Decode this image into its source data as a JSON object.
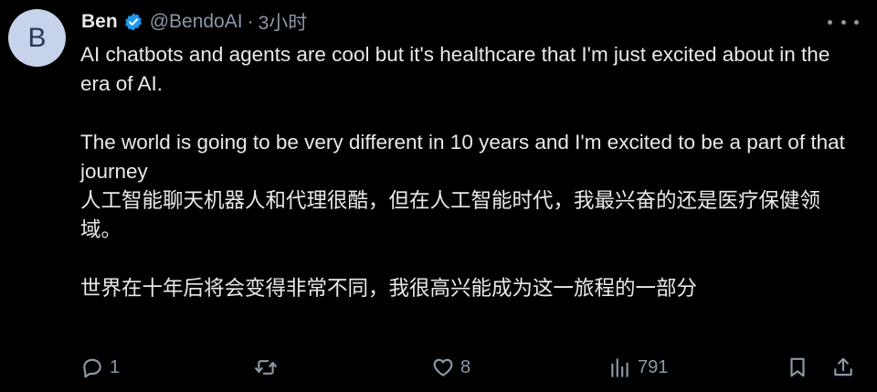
{
  "author": {
    "avatar_letter": "B",
    "name": "Ben",
    "handle": "@BendoAI",
    "separator": "·",
    "time": "3小时"
  },
  "tweet": {
    "paragraph1": "AI chatbots and agents are cool but it's healthcare that I'm just excited about in the era of AI.",
    "paragraph2": "The world is going to be very different in 10 years and I'm excited to be a part of that journey",
    "translation1": "人工智能聊天机器人和代理很酷，但在人工智能时代，我最兴奋的还是医疗保健领域。",
    "translation2": "世界在十年后将会变得非常不同，我很高兴能成为这一旅程的一部分"
  },
  "actions": {
    "replies": "1",
    "retweets": "",
    "likes": "8",
    "views": "791"
  },
  "colors": {
    "background": "#000000",
    "text": "#e7e9ea",
    "muted": "#8b98a5",
    "verified": "#1d9bf0"
  },
  "icons": [
    "verified-badge-icon",
    "more-icon",
    "reply-icon",
    "retweet-icon",
    "like-icon",
    "views-icon",
    "bookmark-icon",
    "share-icon"
  ]
}
